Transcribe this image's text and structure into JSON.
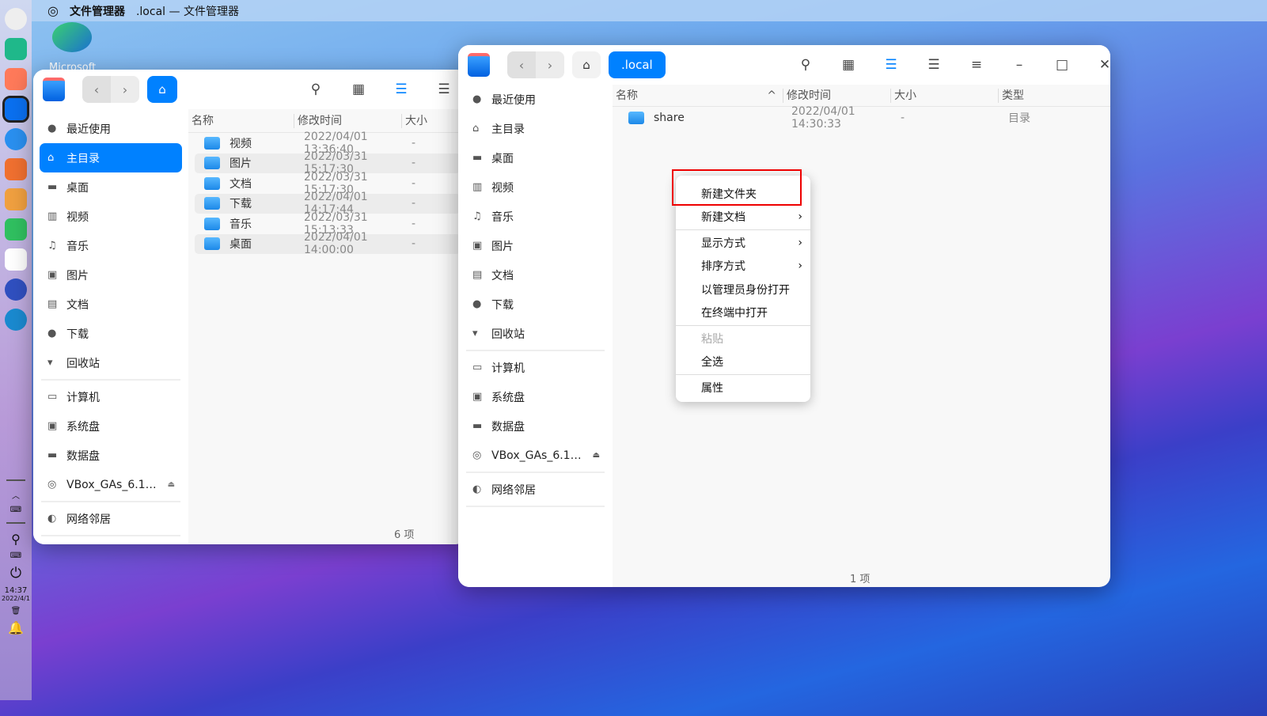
{
  "topbar": {
    "app_name": "文件管理器",
    "window_title": ".local — 文件管理器"
  },
  "desktop": {
    "icon_label": "Microsoft"
  },
  "dock": {
    "time": "14:37",
    "date": "2022/4/1"
  },
  "sidebar": {
    "items": [
      {
        "label": "最近使用",
        "icon": "clock-icon"
      },
      {
        "label": "主目录",
        "icon": "home-icon"
      },
      {
        "label": "桌面",
        "icon": "desktop-icon"
      },
      {
        "label": "视频",
        "icon": "video-icon"
      },
      {
        "label": "音乐",
        "icon": "music-icon"
      },
      {
        "label": "图片",
        "icon": "picture-icon"
      },
      {
        "label": "文档",
        "icon": "document-icon"
      },
      {
        "label": "下载",
        "icon": "download-icon"
      },
      {
        "label": "回收站",
        "icon": "trash-icon"
      },
      {
        "label": "计算机",
        "icon": "computer-icon"
      },
      {
        "label": "系统盘",
        "icon": "disk-icon"
      },
      {
        "label": "数据盘",
        "icon": "disk-icon"
      },
      {
        "label": "VBox_GAs_6.1…",
        "icon": "cdrom-icon"
      },
      {
        "label": "网络邻居",
        "icon": "network-icon"
      }
    ]
  },
  "columns": {
    "name": "名称",
    "modified": "修改时间",
    "size": "大小",
    "type": "类型"
  },
  "back_window": {
    "files": [
      {
        "name": "视频",
        "modified": "2022/04/01 13:36:40",
        "size": "-"
      },
      {
        "name": "图片",
        "modified": "2022/03/31 15:17:30",
        "size": "-"
      },
      {
        "name": "文档",
        "modified": "2022/03/31 15:17:30",
        "size": "-"
      },
      {
        "name": "下载",
        "modified": "2022/04/01 14:17:44",
        "size": "-"
      },
      {
        "name": "音乐",
        "modified": "2022/03/31 15:13:33",
        "size": "-"
      },
      {
        "name": "桌面",
        "modified": "2022/04/01 14:00:00",
        "size": "-"
      }
    ],
    "status": "6 项"
  },
  "front_window": {
    "breadcrumb": ".local",
    "files": [
      {
        "name": "share",
        "modified": "2022/04/01 14:30:33",
        "size": "-",
        "type": "目录"
      }
    ],
    "status": "1 项"
  },
  "context_menu": {
    "items": [
      "新建文件夹",
      "新建文档",
      "显示方式",
      "排序方式",
      "以管理员身份打开",
      "在终端中打开",
      "粘贴",
      "全选",
      "属性"
    ]
  },
  "colors": {
    "accent": "#0081ff",
    "highlight_box": "#ee0000"
  }
}
